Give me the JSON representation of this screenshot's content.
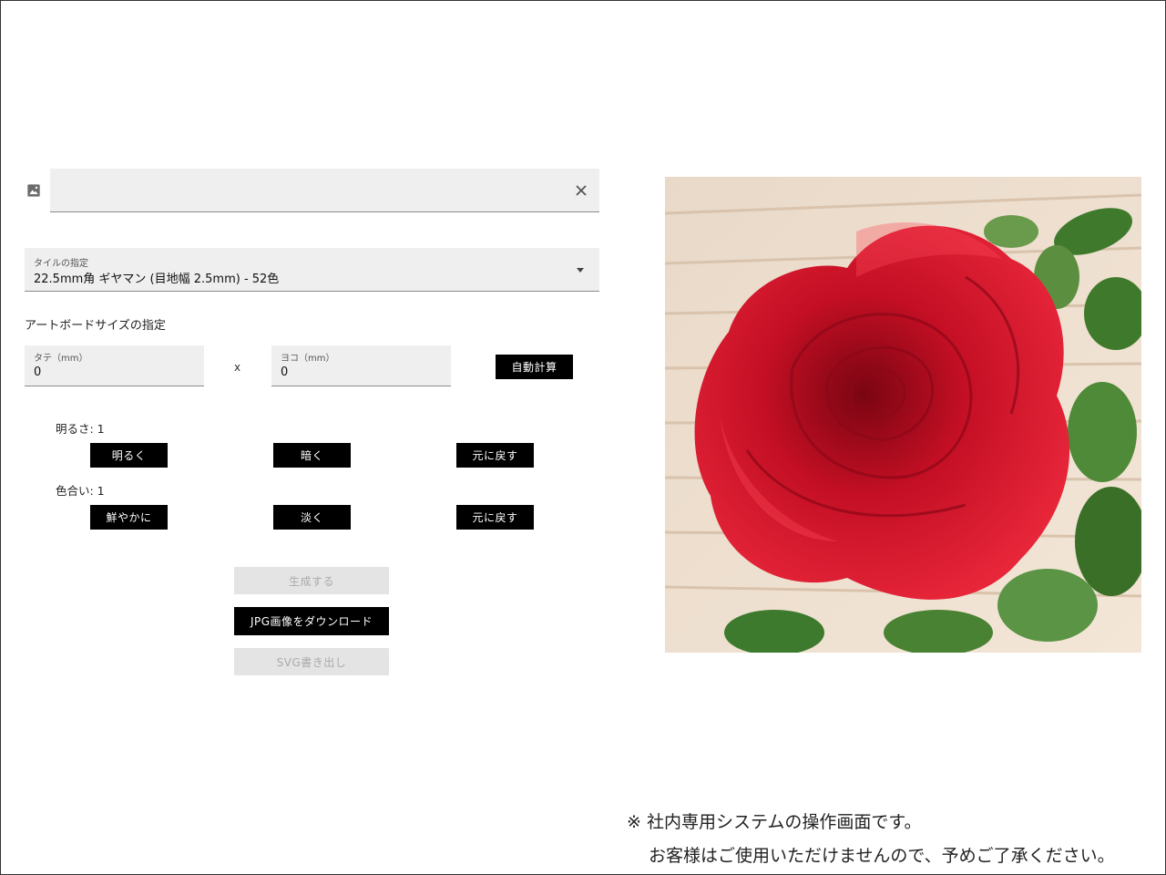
{
  "file_input": {
    "icon": "image-icon",
    "value": "",
    "clear_icon": "close-icon"
  },
  "tile_select": {
    "label": "タイルの指定",
    "value": "22.5mm角 ギヤマン (目地幅 2.5mm) - 52色"
  },
  "artboard": {
    "title": "アートボードサイズの指定",
    "height_label": "タテ（mm）",
    "height_value": "0",
    "separator": "x",
    "width_label": "ヨコ（mm）",
    "width_value": "0",
    "auto_calc_label": "自動計算"
  },
  "brightness": {
    "label": "明るさ: 1",
    "brighter": "明るく",
    "darker": "暗く",
    "reset": "元に戻す"
  },
  "saturation": {
    "label": "色合い: 1",
    "vivid": "鮮やかに",
    "pale": "淡く",
    "reset": "元に戻す"
  },
  "actions": {
    "generate": "生成する",
    "download_jpg": "JPG画像をダウンロード",
    "export_svg": "SVG書き出し"
  },
  "notice": {
    "line1": "※ 社内専用システムの操作画面です。",
    "line2": "お客様はご使用いただけませんので、予めご了承ください。"
  },
  "colors": {
    "button_bg": "#000000",
    "field_bg": "#efefef",
    "disabled_bg": "#e4e4e4",
    "rose": "#d3112a"
  }
}
